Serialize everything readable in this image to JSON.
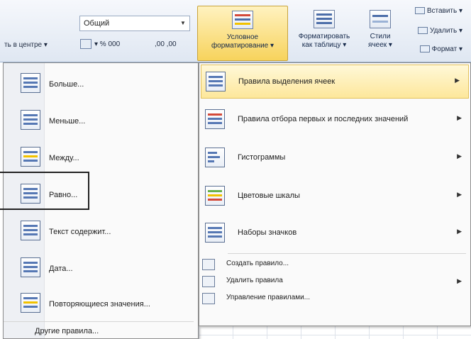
{
  "ribbon": {
    "align_label": "ть в центре ▾",
    "number_format": "Общий",
    "num_btns": "▾ % 000",
    "dec_btns": ",00 ,00",
    "conditional_formatting": "Условное форматирование ▾",
    "format_as_table": "Форматировать как таблицу ▾",
    "cell_styles": "Стили ячеек ▾",
    "insert": "Вставить ▾",
    "delete": "Удалить ▾",
    "format": "Формат ▾"
  },
  "left_menu": {
    "items": [
      {
        "label": "Больше..."
      },
      {
        "label": "Меньше..."
      },
      {
        "label": "Между..."
      },
      {
        "label": "Равно..."
      },
      {
        "label": "Текст содержит..."
      },
      {
        "label": "Дата..."
      },
      {
        "label": "Повторяющиеся значения..."
      }
    ],
    "more_rules": "Другие правила..."
  },
  "right_menu": {
    "items": [
      {
        "label": "Правила выделения ячеек"
      },
      {
        "label": "Правила отбора первых и последних значений"
      },
      {
        "label": "Гистограммы"
      },
      {
        "label": "Цветовые шкалы"
      },
      {
        "label": "Наборы значков"
      }
    ],
    "commands": [
      {
        "label": "Создать правило..."
      },
      {
        "label": "Удалить правила"
      },
      {
        "label": "Управление правилами..."
      }
    ]
  },
  "colors": {
    "highlight": "#fde79b",
    "accent": "#f7d35c"
  }
}
